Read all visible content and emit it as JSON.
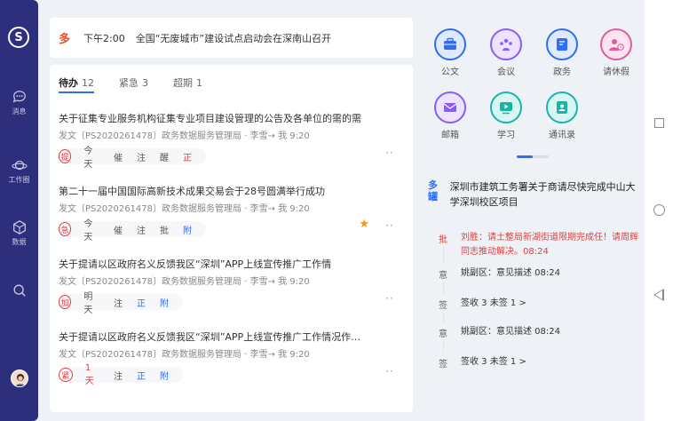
{
  "rail": {
    "items": [
      {
        "label": "消息",
        "icon": "chat-icon"
      },
      {
        "label": "工作圈",
        "icon": "planet-icon"
      },
      {
        "label": "数据",
        "icon": "cube-icon"
      },
      {
        "label": "",
        "icon": "search-icon"
      }
    ]
  },
  "notice": {
    "time": "下午2:00",
    "text": "全国“无废城市”建设试点启动会在深南山召开"
  },
  "tabs": [
    {
      "label": "待办",
      "count": "12"
    },
    {
      "label": "紧急",
      "count": "3"
    },
    {
      "label": "超期",
      "count": "1"
    }
  ],
  "tasks": [
    {
      "title": "关于征集专业服务机构征集专业项目建设管理的公告及各单位的需的需",
      "meta": "发文〔PS2020261478〕政务数据服务管理局 · 李雪→ 我    9:20",
      "badge": "提",
      "actions": [
        "今天",
        "催",
        "注",
        "醒",
        "正"
      ],
      "starred": false
    },
    {
      "title": "第二十一届中国国际高新技术成果交易会于28号圆满举行成功",
      "meta": "发文〔PS2020261478〕政务数据服务管理局 · 李雪→ 我    9:20",
      "badge": "急",
      "actions": [
        "今天",
        "催",
        "注",
        "批",
        "附"
      ],
      "starred": true
    },
    {
      "title": "关于提请以区政府名义反馈我区“深圳”APP上线宣传推广工作情",
      "meta": "发文〔PS2020261478〕政务数据服务管理局 · 李雪→ 我    9:20",
      "badge": "加",
      "actions": [
        "明天",
        "注",
        "正",
        "附"
      ],
      "starred": false
    },
    {
      "title": "关于提请以区政府名义反馈我区“深圳”APP上线宣传推广工作情况作…",
      "meta": "发文〔PS2020261478〕政务数据服务管理局 · 李雪→ 我    9:20",
      "badge": "紧",
      "actions": [
        "1天",
        "注",
        "正",
        "附"
      ],
      "starred": false
    }
  ],
  "apps": [
    {
      "label": "公文",
      "icon": "briefcase-icon",
      "color": "#2e6df6",
      "bg": "#dfe9ff"
    },
    {
      "label": "会议",
      "icon": "meeting-icon",
      "color": "#8a5cf6",
      "bg": "#ece4ff"
    },
    {
      "label": "政务",
      "icon": "document-icon",
      "color": "#2e6df6",
      "bg": "#dfe9ff"
    },
    {
      "label": "请休假",
      "icon": "leave-icon",
      "color": "#e05ca0",
      "bg": "#fde3ef"
    },
    {
      "label": "邮箱",
      "icon": "mail-icon",
      "color": "#8a5cf6",
      "bg": "#ece4ff"
    },
    {
      "label": "学习",
      "icon": "video-icon",
      "color": "#19b4a8",
      "bg": "#d9f5f2"
    },
    {
      "label": "通讯录",
      "icon": "contacts-icon",
      "color": "#19b4a8",
      "bg": "#d9f5f2"
    }
  ],
  "message": {
    "title": "深圳市建筑工务署关于商请尽快完成中山大学深圳校区项目",
    "timeline": [
      {
        "dot": "批",
        "text": "刘胜：请土整局新湖街道限期完成任！请周辉同志推动解决。08:24",
        "red": true
      },
      {
        "dot": "意",
        "text": "姚副区：意见描述  08:24",
        "red": false
      },
      {
        "dot": "签",
        "text": "签收 3   未签 1    >",
        "red": false
      },
      {
        "dot": "意",
        "text": "姚副区：意见描述  08:24",
        "red": false
      },
      {
        "dot": "签",
        "text": "签收 3   未签 1    >",
        "red": false
      }
    ]
  },
  "colors": {
    "rail": "#2e2f7c",
    "accent": "#2e6df6",
    "alert": "#e04040",
    "star": "#f0961c"
  }
}
